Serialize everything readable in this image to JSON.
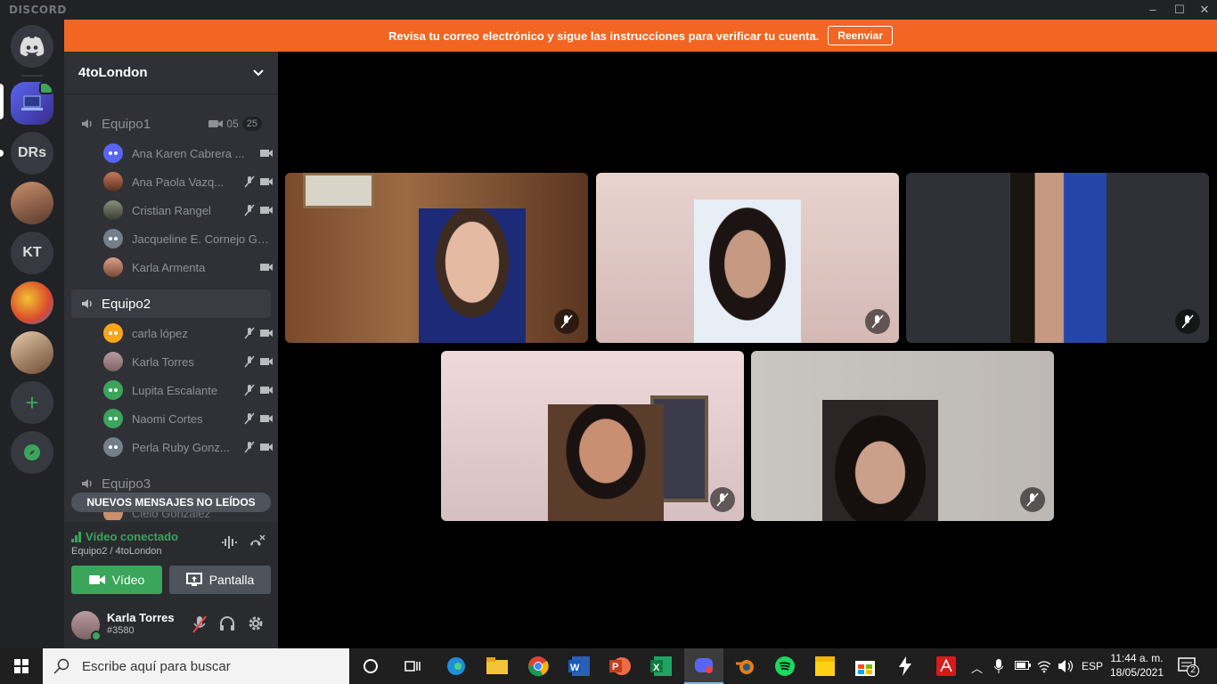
{
  "app": {
    "brand": "DISCORD"
  },
  "guilds": [
    {
      "label": "DRs"
    },
    {
      "label": "KT"
    }
  ],
  "server": {
    "name": "4toLondon"
  },
  "banner": {
    "text": "Revisa tu correo electrónico y sigue las instrucciones para verificar tu cuenta.",
    "button": "Reenviar"
  },
  "channels": [
    {
      "name": "Equipo1",
      "cam": "05",
      "count": "25",
      "users": [
        "Ana Karen Cabrera ...",
        "Ana Paola Vazq...",
        "Cristian Rangel",
        "Jacqueline E. Cornejo Ga...",
        "Karla Armenta"
      ]
    },
    {
      "name": "Equipo2",
      "users": [
        "carla lópez",
        "Karla Torres",
        "Lupita Escalante",
        "Naomi Cortes",
        "Perla Ruby Gonz..."
      ]
    },
    {
      "name": "Equipo3",
      "users": [
        "Cielo González"
      ]
    }
  ],
  "unread": "NUEVOS MENSAJES NO LEÍDOS",
  "rtc": {
    "status": "Vídeo conectado",
    "location": "Equipo2 / 4toLondon",
    "video_btn": "Vídeo",
    "screen_btn": "Pantalla"
  },
  "user": {
    "name": "Karla Torres",
    "tag": "#3580"
  },
  "taskbar": {
    "search_placeholder": "Escribe aquí para buscar",
    "lang": "ESP",
    "time": "11:44 a. m.",
    "date": "18/05/2021",
    "notifications": "2"
  },
  "colors": {
    "accent": "#5865f2",
    "green": "#3ba55c",
    "banner": "#f26522"
  }
}
